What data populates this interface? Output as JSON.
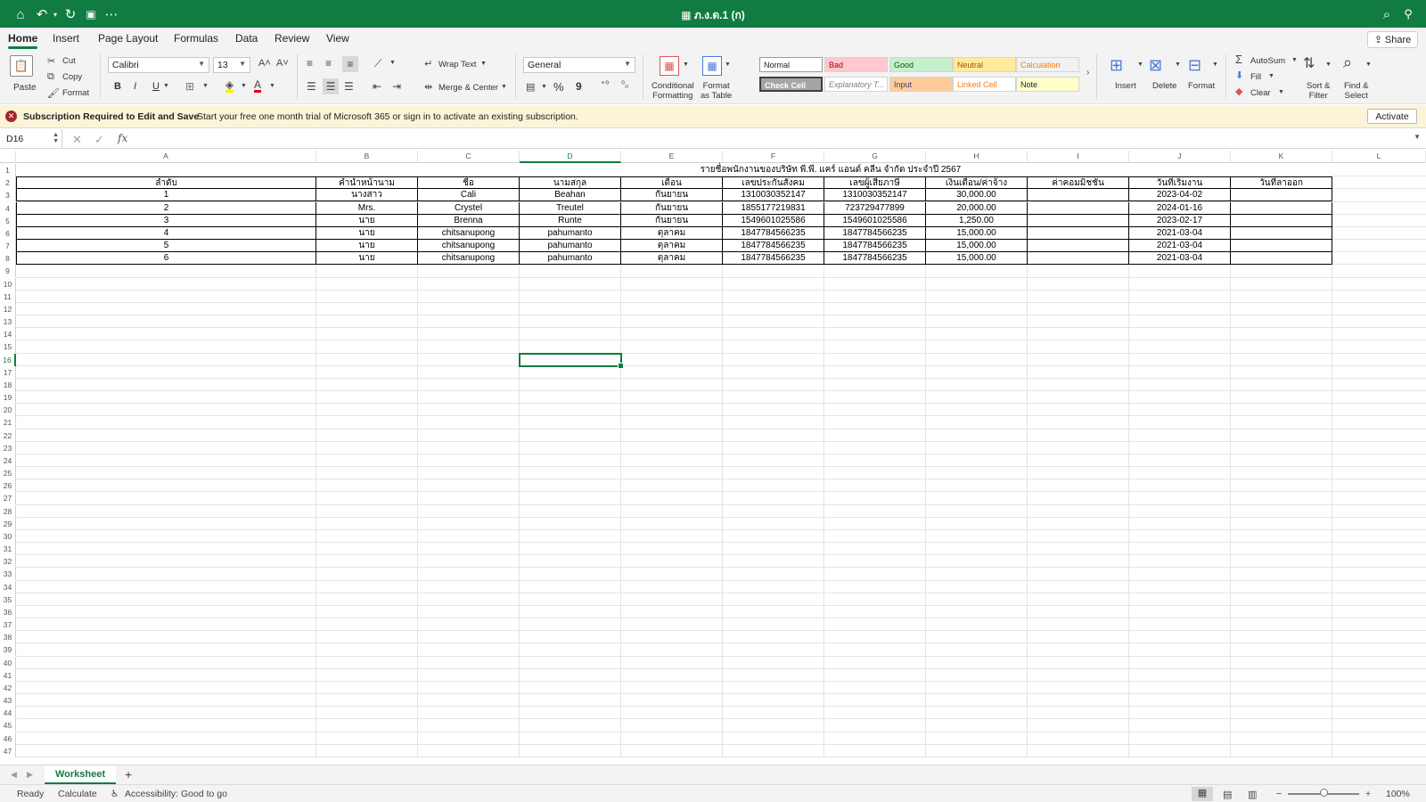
{
  "titlebar": {
    "doc_title": "ภ.ง.ด.1 (ก)",
    "icons": [
      "home-icon",
      "undo-icon",
      "redo-icon",
      "save-icon",
      "more-icon",
      "search-icon",
      "account-icon"
    ],
    "bg_color": "#107c41"
  },
  "menu": {
    "tabs": [
      "Home",
      "Insert",
      "Page Layout",
      "Formulas",
      "Data",
      "Review",
      "View"
    ],
    "active_tab": "Home",
    "share_label": "Share"
  },
  "ribbon": {
    "clipboard": {
      "paste": "Paste",
      "cut": "Cut",
      "copy": "Copy",
      "format": "Format"
    },
    "font": {
      "name": "Calibri",
      "size": "13",
      "bold": "B",
      "italic": "I",
      "underline": "U"
    },
    "alignment": {
      "wrap_text": "Wrap Text",
      "merge_center": "Merge & Center"
    },
    "number": {
      "format": "General",
      "percent": "%",
      "comma": "9"
    },
    "styles": {
      "conditional": "Conditional Formatting",
      "conditional_l1": "Conditional",
      "conditional_l2": "Formatting",
      "format_table_l1": "Format",
      "format_table_l2": "as Table",
      "cells": [
        {
          "label": "Normal",
          "bg": "#ffffff",
          "fg": "#222222"
        },
        {
          "label": "Bad",
          "bg": "#ffc7ce",
          "fg": "#9c0006"
        },
        {
          "label": "Good",
          "bg": "#c6efce",
          "fg": "#006100"
        },
        {
          "label": "Neutral",
          "bg": "#ffeb9c",
          "fg": "#9c5700"
        },
        {
          "label": "Calculation",
          "bg": "#f2f2f2",
          "fg": "#fa7d00"
        },
        {
          "label": "Check Cell",
          "bg": "#a5a5a5",
          "fg": "#ffffff"
        },
        {
          "label": "Explanatory T...",
          "bg": "#ffffff",
          "fg": "#7f7f7f"
        },
        {
          "label": "Input",
          "bg": "#ffcc99",
          "fg": "#3f3f76"
        },
        {
          "label": "Linked Cell",
          "bg": "#ffffff",
          "fg": "#fa7d00"
        },
        {
          "label": "Note",
          "bg": "#ffffcc",
          "fg": "#222222"
        }
      ]
    },
    "cells": {
      "insert": "Insert",
      "delete": "Delete",
      "format": "Format"
    },
    "editing": {
      "autosum": "AutoSum",
      "fill": "Fill",
      "clear": "Clear",
      "sort_l1": "Sort &",
      "sort_l2": "Filter",
      "find_l1": "Find &",
      "find_l2": "Select"
    }
  },
  "message_bar": {
    "title": "Subscription Required to Edit and Save",
    "text": "Start your free one month trial of Microsoft 365 or sign in to activate an existing subscription.",
    "button": "Activate"
  },
  "formula_bar": {
    "name_box": "D16",
    "fx": "fx",
    "formula": ""
  },
  "sheet": {
    "columns": [
      "A",
      "B",
      "C",
      "D",
      "E",
      "F",
      "G",
      "H",
      "I",
      "J",
      "K",
      "L"
    ],
    "selected_column": "D",
    "selected_row": "16",
    "selected_cell": "D16",
    "title": "รายชื่อพนักงานของบริษัท พี.พี. แคร์ แอนด์ คลีน จำกัด ประจำปี 2567",
    "headers": [
      "ลำดับ",
      "คำนำหน้านาม",
      "ชื่อ",
      "นามสกุล",
      "เดือน",
      "เลขประกันสังคม",
      "เลขผู้เสียภาษี",
      "เงินเดือน/ค่าจ้าง",
      "ค่าคอมมิชชั่น",
      "วันที่เริ่มงาน",
      "วันที่ลาออก"
    ],
    "rows": [
      [
        "1",
        "นางสาว",
        "Cali",
        "Beahan",
        "กันยายน",
        "1310030352147",
        "1310030352147",
        "30,000.00",
        "",
        "2023-04-02",
        ""
      ],
      [
        "2",
        "Mrs.",
        "Crystel",
        "Treutel",
        "กันยายน",
        "1855177219831",
        "723729477899",
        "20,000.00",
        "",
        "2024-01-16",
        ""
      ],
      [
        "3",
        "นาย",
        "Brenna",
        "Runte",
        "กันยายน",
        "1549601025586",
        "1549601025586",
        "1,250.00",
        "",
        "2023-02-17",
        ""
      ],
      [
        "4",
        "นาย",
        "chitsanupong",
        "pahumanto",
        "ตุลาคม",
        "1847784566235",
        "1847784566235",
        "15,000.00",
        "",
        "2021-03-04",
        ""
      ],
      [
        "5",
        "นาย",
        "chitsanupong",
        "pahumanto",
        "ตุลาคม",
        "1847784566235",
        "1847784566235",
        "15,000.00",
        "",
        "2021-03-04",
        ""
      ],
      [
        "6",
        "นาย",
        "chitsanupong",
        "pahumanto",
        "ตุลาคม",
        "1847784566235",
        "1847784566235",
        "15,000.00",
        "",
        "2021-03-04",
        ""
      ]
    ],
    "row_count": 47
  },
  "sheet_tabs": {
    "active": "Worksheet",
    "add": "+"
  },
  "status_bar": {
    "ready": "Ready",
    "calculate": "Calculate",
    "accessibility": "Accessibility: Good to go",
    "zoom": "100%"
  }
}
